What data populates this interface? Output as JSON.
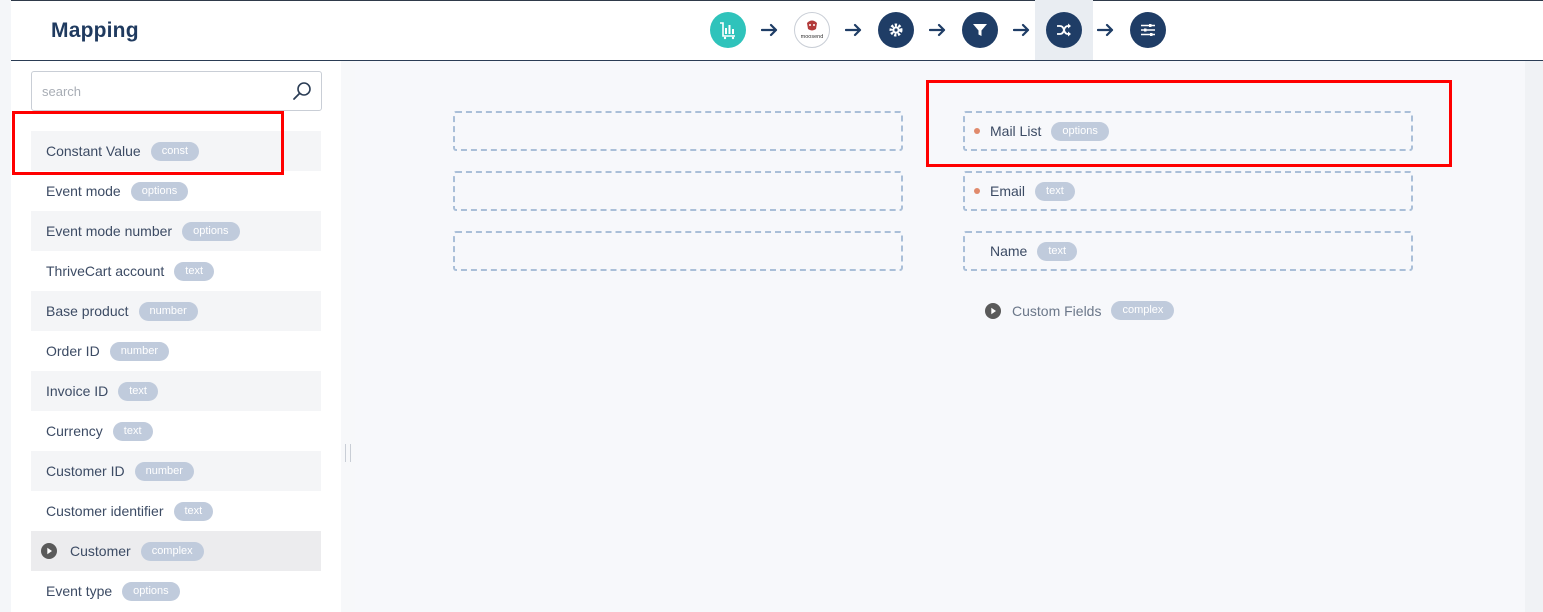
{
  "header": {
    "title": "Mapping",
    "logo_text": "moosend"
  },
  "search": {
    "placeholder": "search",
    "value": ""
  },
  "source_fields": [
    {
      "label": "Constant Value",
      "type": "const"
    },
    {
      "label": "Event mode",
      "type": "options"
    },
    {
      "label": "Event mode number",
      "type": "options"
    },
    {
      "label": "ThriveCart account",
      "type": "text"
    },
    {
      "label": "Base product",
      "type": "number"
    },
    {
      "label": "Order ID",
      "type": "number"
    },
    {
      "label": "Invoice ID",
      "type": "text"
    },
    {
      "label": "Currency",
      "type": "text"
    },
    {
      "label": "Customer ID",
      "type": "number"
    },
    {
      "label": "Customer identifier",
      "type": "text"
    },
    {
      "label": "Customer",
      "type": "complex"
    },
    {
      "label": "Event type",
      "type": "options"
    }
  ],
  "target_fields": [
    {
      "label": "Mail List",
      "type": "options",
      "required": true
    },
    {
      "label": "Email",
      "type": "text",
      "required": true
    },
    {
      "label": "Name",
      "type": "text",
      "required": false
    }
  ],
  "custom_fields": {
    "label": "Custom Fields",
    "type": "complex"
  },
  "colors": {
    "accent": "#1f3d66",
    "teal": "#2fc3bb",
    "badge": "#c0cbdc",
    "required_dot": "#e08a6c",
    "highlight": "#ff0000"
  },
  "steps": [
    {
      "icon": "chart-cart-icon"
    },
    {
      "icon": "moosend-logo-icon"
    },
    {
      "icon": "gear-icon"
    },
    {
      "icon": "filter-icon"
    },
    {
      "icon": "shuffle-icon",
      "active": true
    },
    {
      "icon": "sliders-icon"
    }
  ]
}
